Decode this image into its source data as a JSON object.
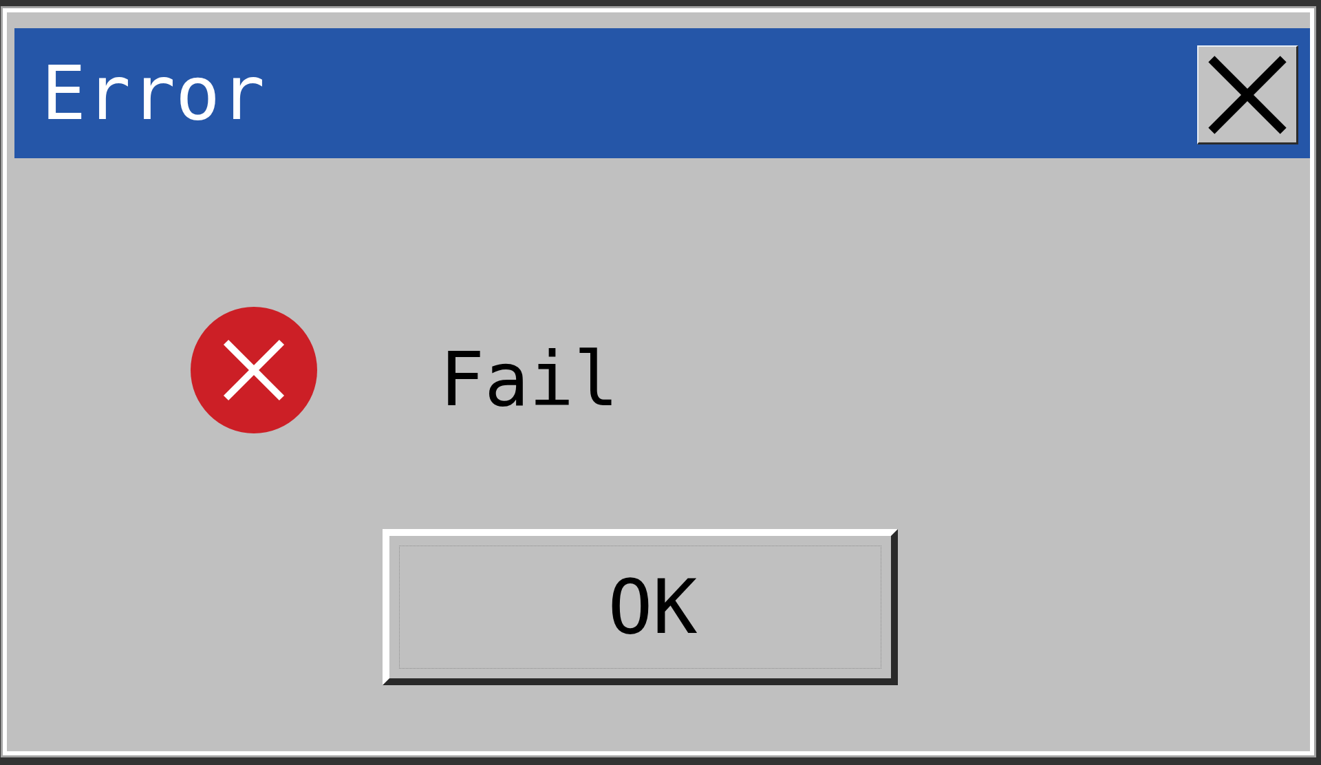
{
  "window": {
    "title": "Error"
  },
  "message": "Fail",
  "buttons": [
    {
      "label": "OK",
      "focused": true
    }
  ]
}
